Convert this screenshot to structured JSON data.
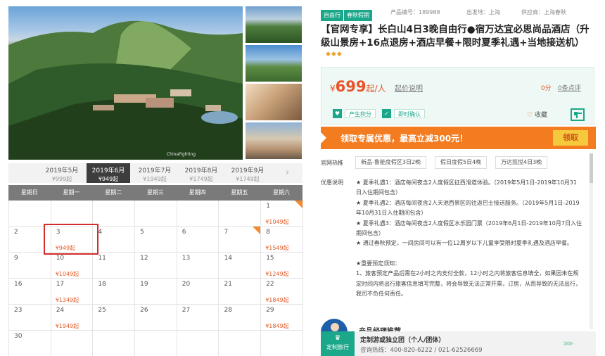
{
  "gallery": {
    "hero_watermark": "ChinaFighting",
    "thumbnails": [
      "thumb-1",
      "thumb-2",
      "thumb-3",
      "thumb-4"
    ]
  },
  "calendar": {
    "months": [
      {
        "label": "2019年5月",
        "price": "¥999起"
      },
      {
        "label": "2019年6月",
        "price": "¥949起"
      },
      {
        "label": "2019年7月",
        "price": "¥1949起"
      },
      {
        "label": "2019年8月",
        "price": "¥1749起"
      },
      {
        "label": "2019年9月",
        "price": "¥1749起"
      }
    ],
    "next_icon": "chevron-right-icon",
    "weekdays": [
      "星期日",
      "星期一",
      "星期二",
      "星期三",
      "星期四",
      "星期五",
      "星期六"
    ],
    "days": [
      {
        "d": "1",
        "price": "¥1049起",
        "tag": true
      },
      {
        "d": "2",
        "price": ""
      },
      {
        "d": "3",
        "price": "¥949起"
      },
      {
        "d": "4",
        "price": ""
      },
      {
        "d": "5",
        "price": ""
      },
      {
        "d": "6",
        "price": ""
      },
      {
        "d": "7",
        "price": "",
        "tag": true
      },
      {
        "d": "8",
        "price": "¥1549起"
      },
      {
        "d": "9",
        "price": ""
      },
      {
        "d": "10",
        "price": "¥1049起"
      },
      {
        "d": "11",
        "price": ""
      },
      {
        "d": "12",
        "price": ""
      },
      {
        "d": "13",
        "price": ""
      },
      {
        "d": "14",
        "price": ""
      },
      {
        "d": "15",
        "price": "¥1249起"
      },
      {
        "d": "16",
        "price": ""
      },
      {
        "d": "17",
        "price": "¥1349起"
      },
      {
        "d": "18",
        "price": ""
      },
      {
        "d": "19",
        "price": ""
      },
      {
        "d": "20",
        "price": ""
      },
      {
        "d": "21",
        "price": ""
      },
      {
        "d": "22",
        "price": "¥1849起"
      },
      {
        "d": "23",
        "price": ""
      },
      {
        "d": "24",
        "price": "¥1949起"
      },
      {
        "d": "25",
        "price": ""
      },
      {
        "d": "26",
        "price": ""
      },
      {
        "d": "27",
        "price": ""
      },
      {
        "d": "28",
        "price": ""
      },
      {
        "d": "29",
        "price": "¥1849起"
      },
      {
        "d": "30",
        "price": ""
      }
    ]
  },
  "product": {
    "tags": [
      "自由行",
      "春秋假期"
    ],
    "code": "产品编号：189988",
    "departure": "出发地：上海",
    "supplier": "供应商：上海春秋",
    "title": "【官网专享】长白山4日3晚自由行●宿万达宜必思尚品酒店（升级山景房+16点退房+酒店早餐+限时夏季礼遇+当地接送机）",
    "diamonds": "◆◆◆",
    "price_symbol": "¥",
    "price_value": "699",
    "price_unit": "起/人",
    "price_note": "起价说明",
    "score": "0分",
    "reviews": "0条点评",
    "badge_points": "产生积分",
    "badge_confirm": "即时确认",
    "collect": "收藏",
    "collect_icon": "heart-icon",
    "qr_icon": "qr-code-icon"
  },
  "promo": {
    "text": "领取专属优惠，最高立减300元！",
    "button": "领取"
  },
  "recommend": {
    "label": "官网热推",
    "items": [
      "新品-鲁能度假区3日2晚",
      "假日度假5日4晚",
      "万达凯悦4日3晚"
    ]
  },
  "offers": {
    "label": "优惠说明",
    "lines": [
      "★ 夏季礼遇1：酒店每间夜含2人度假区征西滑道体验。（2019年5月1日-2019年10月31日入住期间包含）",
      "★ 夏季礼遇2：酒店每间夜含2人天池西景区的往返巴士接送服务。（2019年5月1日-2019年10月31日入住期间包含）",
      "★ 夏季礼遇3：酒店每间夜含2人度假区水乐园门票（2019年6月1日-2019年10月7日入住期间包含）",
      "★ 通过春秋预定，一间房间可以有一位12周岁以下儿童享受限时夏季礼遇及酒店早餐。",
      "",
      "★重要预定须知：",
      "1、旅客预定产品后需在2小时之内支付全款，12小时之内将旅客信息填全，如果因未在规定时间内将出行旅客信息填写完整，将会导致无法正常开票，订房，从而导致的无法出行，我司不负任何责任。"
    ]
  },
  "manager": {
    "title": "产品经理推荐"
  },
  "custom": {
    "badge_crown": "♛",
    "badge_text": "定制旅行",
    "line1": "定制游或独立团（个人/团体）",
    "line2": "咨询热线：400-820-6222 / 021-62526669",
    "arrow": "»»"
  }
}
